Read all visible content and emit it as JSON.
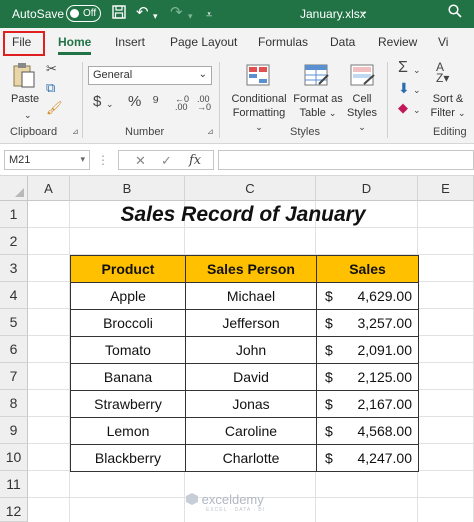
{
  "titlebar": {
    "autosave_label": "AutoSave",
    "autosave_state": "Off",
    "filename": "January.xlsx",
    "filename_chevron": "⌄",
    "icons": [
      "save-icon",
      "undo-icon",
      "undo-dropdown-icon",
      "redo-icon",
      "redo-dropdown-icon",
      "customize-quick-access-icon",
      "search-icon"
    ]
  },
  "tabs": [
    "File",
    "Home",
    "Insert",
    "Page Layout",
    "Formulas",
    "Data",
    "Review",
    "Vi"
  ],
  "active_tab": "Home",
  "ribbon": {
    "clipboard": {
      "paste_label": "Paste",
      "group_label": "Clipboard"
    },
    "number": {
      "format_value": "General",
      "group_label": "Number"
    },
    "styles": {
      "conditional_line1": "Conditional",
      "conditional_line2": "Formatting",
      "format_table_line1": "Format as",
      "format_table_line2": "Table",
      "cell_styles_line1": "Cell",
      "cell_styles_line2": "Styles",
      "group_label": "Styles"
    },
    "editing": {
      "sort_line1": "Sort &",
      "sort_line2": "Filter",
      "group_label": "Editing"
    }
  },
  "formula_bar": {
    "name_box": "M21",
    "fx_label": "fx",
    "formula": ""
  },
  "columns": [
    "A",
    "B",
    "C",
    "D",
    "E"
  ],
  "rows": [
    "1",
    "2",
    "3",
    "4",
    "5",
    "6",
    "7",
    "8",
    "9",
    "10",
    "11",
    "12"
  ],
  "sheet": {
    "title": "Sales Record of January",
    "headers": [
      "Product",
      "Sales Person",
      "Sales"
    ],
    "currency_symbol": "$",
    "records": [
      {
        "product": "Apple",
        "person": "Michael",
        "sales": "4,629.00"
      },
      {
        "product": "Broccoli",
        "person": "Jefferson",
        "sales": "3,257.00"
      },
      {
        "product": "Tomato",
        "person": "John",
        "sales": "2,091.00"
      },
      {
        "product": "Banana",
        "person": "David",
        "sales": "2,125.00"
      },
      {
        "product": "Strawberry",
        "person": "Jonas",
        "sales": "2,167.00"
      },
      {
        "product": "Lemon",
        "person": "Caroline",
        "sales": "4,568.00"
      },
      {
        "product": "Blackberry",
        "person": "Charlotte",
        "sales": "4,247.00"
      }
    ]
  },
  "watermark": {
    "brand": "exceldemy",
    "tagline": "EXCEL · DATA · BI"
  },
  "colors": {
    "excel_green": "#217346",
    "header_fill": "#ffc000",
    "highlight_box": "#e02020"
  }
}
